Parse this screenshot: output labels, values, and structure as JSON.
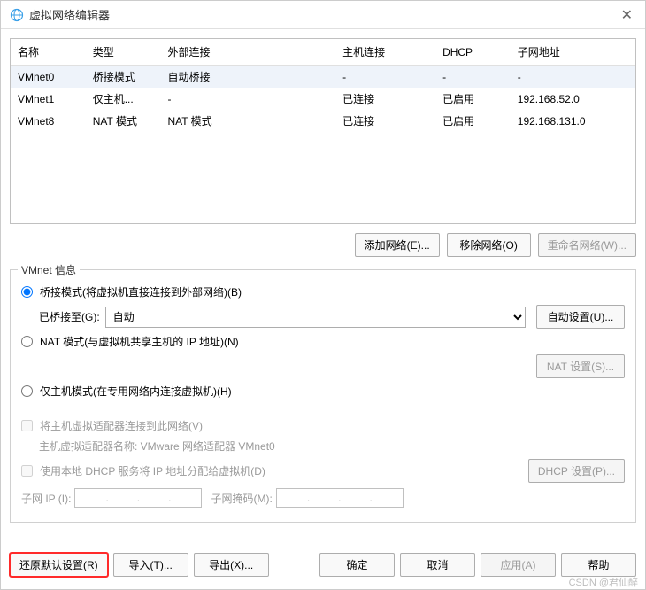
{
  "window": {
    "title": "虚拟网络编辑器"
  },
  "table": {
    "headers": {
      "name": "名称",
      "type": "类型",
      "ext": "外部连接",
      "host": "主机连接",
      "dhcp": "DHCP",
      "subnet": "子网地址"
    },
    "rows": [
      {
        "name": "VMnet0",
        "type": "桥接模式",
        "ext": "自动桥接",
        "host": "-",
        "dhcp": "-",
        "subnet": "-"
      },
      {
        "name": "VMnet1",
        "type": "仅主机...",
        "ext": "-",
        "host": "已连接",
        "dhcp": "已启用",
        "subnet": "192.168.52.0"
      },
      {
        "name": "VMnet8",
        "type": "NAT 模式",
        "ext": "NAT 模式",
        "host": "已连接",
        "dhcp": "已启用",
        "subnet": "192.168.131.0"
      }
    ]
  },
  "netButtons": {
    "add": "添加网络(E)...",
    "remove": "移除网络(O)",
    "rename": "重命名网络(W)..."
  },
  "group": {
    "legend": "VMnet 信息",
    "radio_bridge": "桥接模式(将虚拟机直接连接到外部网络)(B)",
    "bridge_to_label": "已桥接至(G):",
    "bridge_select": "自动",
    "auto_settings": "自动设置(U)...",
    "radio_nat": "NAT 模式(与虚拟机共享主机的 IP 地址)(N)",
    "nat_settings": "NAT 设置(S)...",
    "radio_host": "仅主机模式(在专用网络内连接虚拟机)(H)",
    "check_connect": "将主机虚拟适配器连接到此网络(V)",
    "adapter_label": "主机虚拟适配器名称: VMware 网络适配器 VMnet0",
    "check_dhcp": "使用本地 DHCP 服务将 IP 地址分配给虚拟机(D)",
    "dhcp_settings": "DHCP 设置(P)...",
    "subnet_ip_label": "子网 IP (I):",
    "subnet_mask_label": "子网掩码(M):"
  },
  "bottom": {
    "restore": "还原默认设置(R)",
    "import": "导入(T)...",
    "export": "导出(X)...",
    "ok": "确定",
    "cancel": "取消",
    "apply": "应用(A)",
    "help": "帮助"
  },
  "watermark": "CSDN @君仙醉"
}
